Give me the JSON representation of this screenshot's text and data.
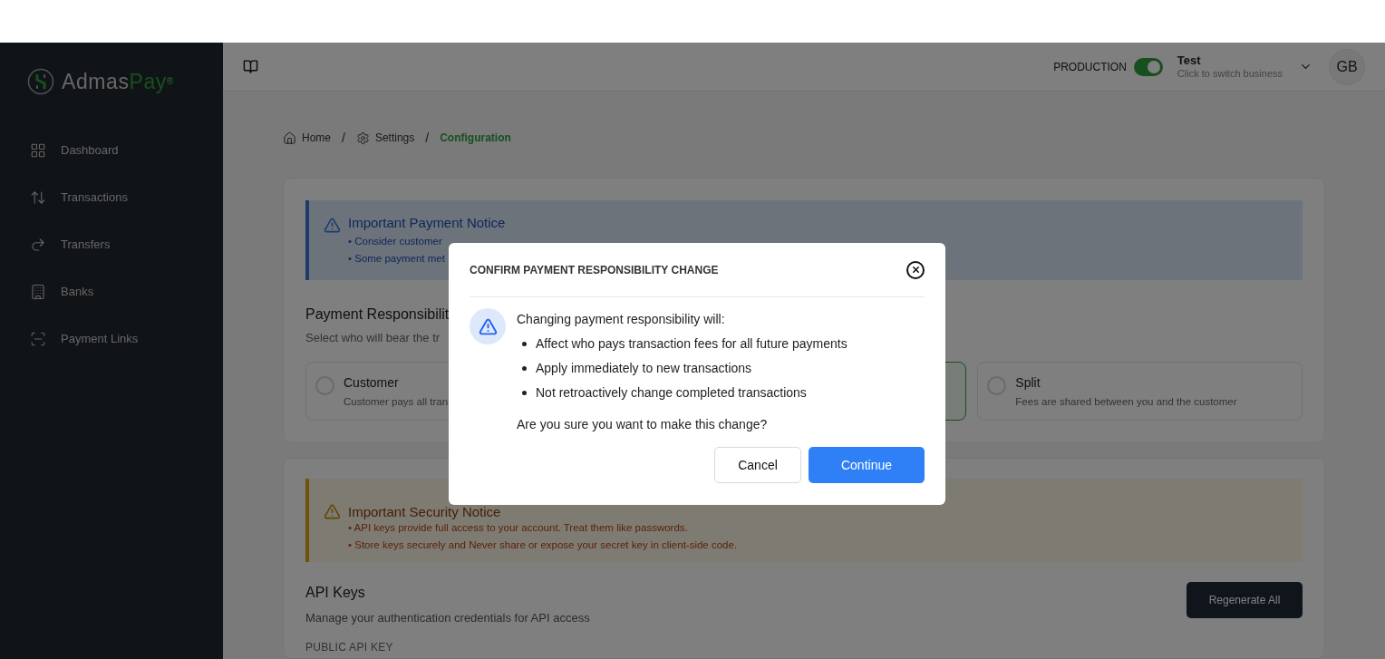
{
  "sidebar": {
    "logo": {
      "name": "Admas",
      "accent": "Pay",
      "mark": "®"
    },
    "items": [
      {
        "label": "Dashboard"
      },
      {
        "label": "Transactions"
      },
      {
        "label": "Transfers"
      },
      {
        "label": "Banks"
      },
      {
        "label": "Payment Links"
      }
    ]
  },
  "header": {
    "production_label": "PRODUCTION",
    "production_on": true,
    "business": {
      "name": "Test",
      "hint": "Click to switch business"
    },
    "avatar": "GB"
  },
  "breadcrumb": {
    "items": [
      {
        "label": "Home",
        "current": false
      },
      {
        "label": "Settings",
        "current": false
      },
      {
        "label": "Configuration",
        "current": true
      }
    ],
    "separators": [
      "/",
      "/"
    ]
  },
  "payment_card": {
    "notice": {
      "title": "Important Payment Notice",
      "lines": [
        "• Consider customer",
        "• Some payment met"
      ]
    },
    "title": "Payment Responsibilit",
    "subtitle": "Select who will bear the tr",
    "options": [
      {
        "title": "Customer",
        "description": "Customer pays all tran",
        "selected": false
      },
      {
        "selected": true
      },
      {
        "title": "Split",
        "description": "Fees are shared between you and the customer",
        "selected": false
      }
    ]
  },
  "api_card": {
    "notice": {
      "title": "Important Security Notice",
      "lines": [
        "• API keys provide full access to your account. Treat them like passwords.",
        "• Store keys securely and Never share or expose your secret key in client-side code."
      ]
    },
    "title": "API Keys",
    "subtitle": "Manage your authentication credentials for API access",
    "button": "Regenerate All",
    "field_label": "PUBLIC API KEY"
  },
  "modal": {
    "title": "CONFIRM PAYMENT RESPONSIBILITY CHANGE",
    "intro": "Changing payment responsibility will:",
    "points": [
      "Affect who pays transaction fees for all future payments",
      "Apply immediately to new transactions",
      "Not retroactively change completed transactions"
    ],
    "question": "Are you sure you want to make this change?",
    "cancel": "Cancel",
    "confirm": "Continue"
  }
}
